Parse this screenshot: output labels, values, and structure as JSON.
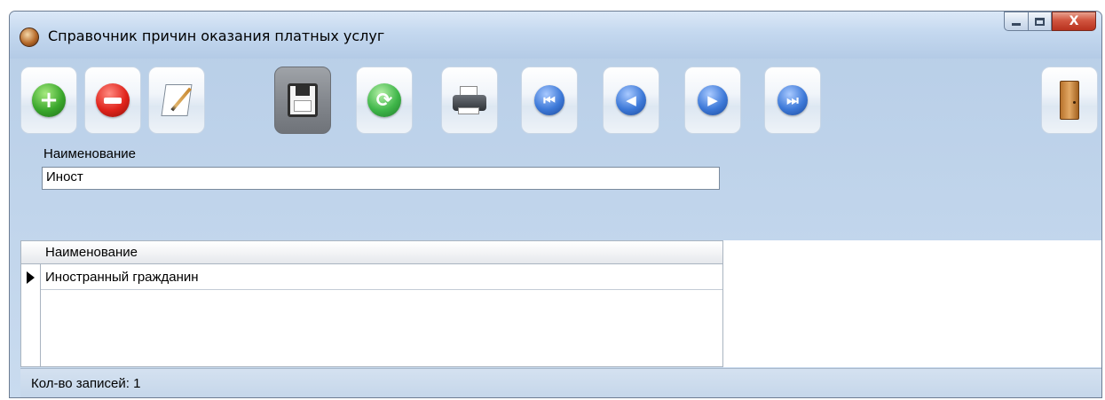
{
  "window": {
    "title": "Справочник причин оказания платных услуг",
    "controls": {
      "minimize": "minimize",
      "maximize": "maximize",
      "close": "X"
    }
  },
  "toolbar": {
    "buttons": [
      {
        "name": "add",
        "icon": "plus-icon",
        "glyph": "+"
      },
      {
        "name": "delete",
        "icon": "minus-icon"
      },
      {
        "name": "edit",
        "icon": "edit-icon"
      },
      {
        "name": "save",
        "icon": "floppy-icon"
      },
      {
        "name": "refresh",
        "icon": "refresh-icon",
        "glyph": "⟳"
      },
      {
        "name": "print",
        "icon": "printer-icon"
      },
      {
        "name": "first",
        "icon": "first-record-icon",
        "glyph": "⏮"
      },
      {
        "name": "prev",
        "icon": "prev-record-icon",
        "glyph": "◀"
      },
      {
        "name": "next",
        "icon": "next-record-icon",
        "glyph": "▶"
      },
      {
        "name": "last",
        "icon": "last-record-icon",
        "glyph": "⏭"
      },
      {
        "name": "exit",
        "icon": "door-icon"
      }
    ]
  },
  "form": {
    "field_label": "Наименование",
    "field_value": "Иност"
  },
  "grid": {
    "columns": [
      "Наименование"
    ],
    "rows": [
      [
        "Иностранный гражданин"
      ]
    ]
  },
  "status": {
    "records_text": "Кол-во записей: 1"
  },
  "colors": {
    "window_bg": "#c3d7ee",
    "close_button": "#d1553f",
    "active_toolbar_button": "#84888e"
  }
}
